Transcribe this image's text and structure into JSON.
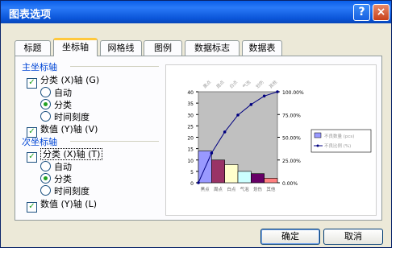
{
  "window": {
    "title": "图表选项",
    "help_icon": "?",
    "close_icon": "×"
  },
  "tabs": [
    {
      "label": "标题",
      "active": false
    },
    {
      "label": "坐标轴",
      "active": true
    },
    {
      "label": "网格线",
      "active": false
    },
    {
      "label": "图例",
      "active": false
    },
    {
      "label": "数据标志",
      "active": false
    },
    {
      "label": "数据表",
      "active": false
    }
  ],
  "primary_axis": {
    "heading": "主坐标轴",
    "category_axis": "分类 (X)轴 (G)",
    "auto": "自动",
    "category": "分类",
    "time_scale": "时间刻度",
    "value_axis": "数值 (Y)轴 (V)"
  },
  "secondary_axis": {
    "heading": "次坐标轴",
    "category_axis": "分类 (X)轴 (T)",
    "auto": "自动",
    "category": "分类",
    "time_scale": "时间刻度",
    "value_axis": "数值 (Y)轴 (L)"
  },
  "buttons": {
    "ok": "确定",
    "cancel": "取消"
  },
  "colors": {
    "accent": "#0046d5",
    "title_bar": "#0a5ee8"
  },
  "chart_data": {
    "type": "bar",
    "top_categories": [
      "黑点",
      "周点",
      "白点",
      "气泡",
      "划伤",
      "其他"
    ],
    "categories": [
      "黑点",
      "周点",
      "白点",
      "气泡",
      "划伤",
      "其他"
    ],
    "values": [
      14,
      10,
      8,
      5,
      4,
      2
    ],
    "bar_colors": [
      "#9999ff",
      "#993366",
      "#ffffcc",
      "#ccffff",
      "#660066",
      "#ff8080"
    ],
    "cumulative_percent": [
      0,
      32.6,
      55.8,
      74.4,
      86,
      95.3,
      100
    ],
    "ylim": [
      0,
      40
    ],
    "yticks": [
      "0",
      "5",
      "10",
      "15",
      "20",
      "25",
      "30",
      "35",
      "40"
    ],
    "y2ticks": [
      "0.00%",
      "25.00%",
      "50.00%",
      "75.00%",
      "100.00%"
    ],
    "legend": [
      "不良数量 (pcs)",
      "不良比例 (%)"
    ],
    "plot_background": "#c0c0c0"
  }
}
